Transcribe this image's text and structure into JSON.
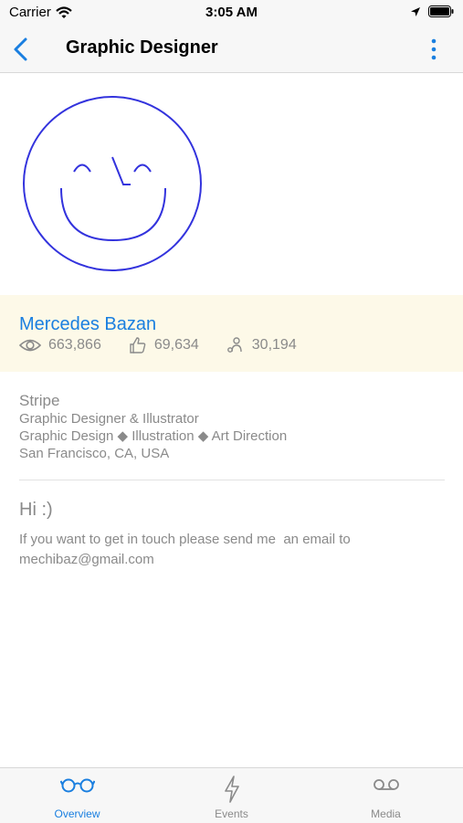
{
  "status_bar": {
    "carrier": "Carrier",
    "time": "3:05 AM"
  },
  "nav": {
    "title": "Graphic Designer"
  },
  "profile": {
    "name": "Mercedes Bazan",
    "views": "663,866",
    "likes": "69,634",
    "followers": "30,194"
  },
  "info": {
    "company": "Stripe",
    "role": "Graphic Designer & Illustrator",
    "skills": "Graphic Design ◆ Illustration ◆ Art Direction",
    "location": "San Francisco, CA, USA"
  },
  "about": {
    "greeting": "Hi :)",
    "message": "If you want to get in touch please send me  an email to mechibaz@gmail.com"
  },
  "tabs": [
    {
      "label": "Overview",
      "icon": "glasses-icon",
      "active": true
    },
    {
      "label": "Events",
      "icon": "lightning-icon",
      "active": false
    },
    {
      "label": "Media",
      "icon": "voicemail-icon",
      "active": false
    }
  ],
  "colors": {
    "accent": "#1a7fe0",
    "avatar_stroke": "#3333dd",
    "band": "#fdf9e8",
    "muted": "#8a8a8a"
  }
}
